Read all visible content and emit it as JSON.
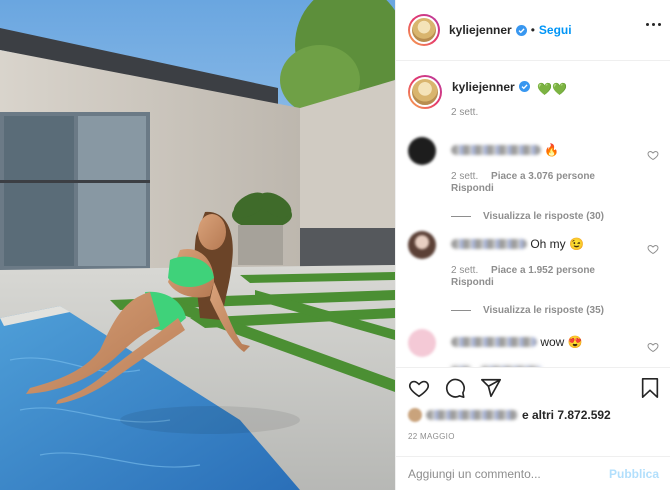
{
  "post": {
    "username": "kyliejenner",
    "separator": "•",
    "follow_label": "Segui",
    "caption_emojis": "💚💚",
    "caption_time": "2 sett."
  },
  "comments": [
    {
      "text": "🔥",
      "time": "2 sett.",
      "likes": "Piace a 3.076 persone",
      "reply_label": "Rispondi",
      "view_replies": "Visualizza le risposte (30)"
    },
    {
      "text": "Oh my 😉",
      "time": "2 sett.",
      "likes": "Piace a 1.952 persone",
      "reply_label": "Rispondi",
      "view_replies": "Visualizza le risposte (35)"
    },
    {
      "text": "wow 😍",
      "time": "",
      "likes": "",
      "reply_label": "",
      "view_replies": ""
    }
  ],
  "footer": {
    "likes_suffix": "e altri 7.872.592",
    "date": "22 MAGGIO",
    "comment_placeholder": "Aggiungi un commento...",
    "publish_label": "Pubblica"
  },
  "icons": {
    "verified": "verified-badge-icon",
    "more": "more-options-icon",
    "like": "heart-icon",
    "comment": "comment-icon",
    "share": "share-icon",
    "save": "bookmark-icon"
  },
  "colors": {
    "accent": "#0095f6",
    "publish_disabled": "#b2dffc",
    "meta_text": "#8e8e8e"
  }
}
